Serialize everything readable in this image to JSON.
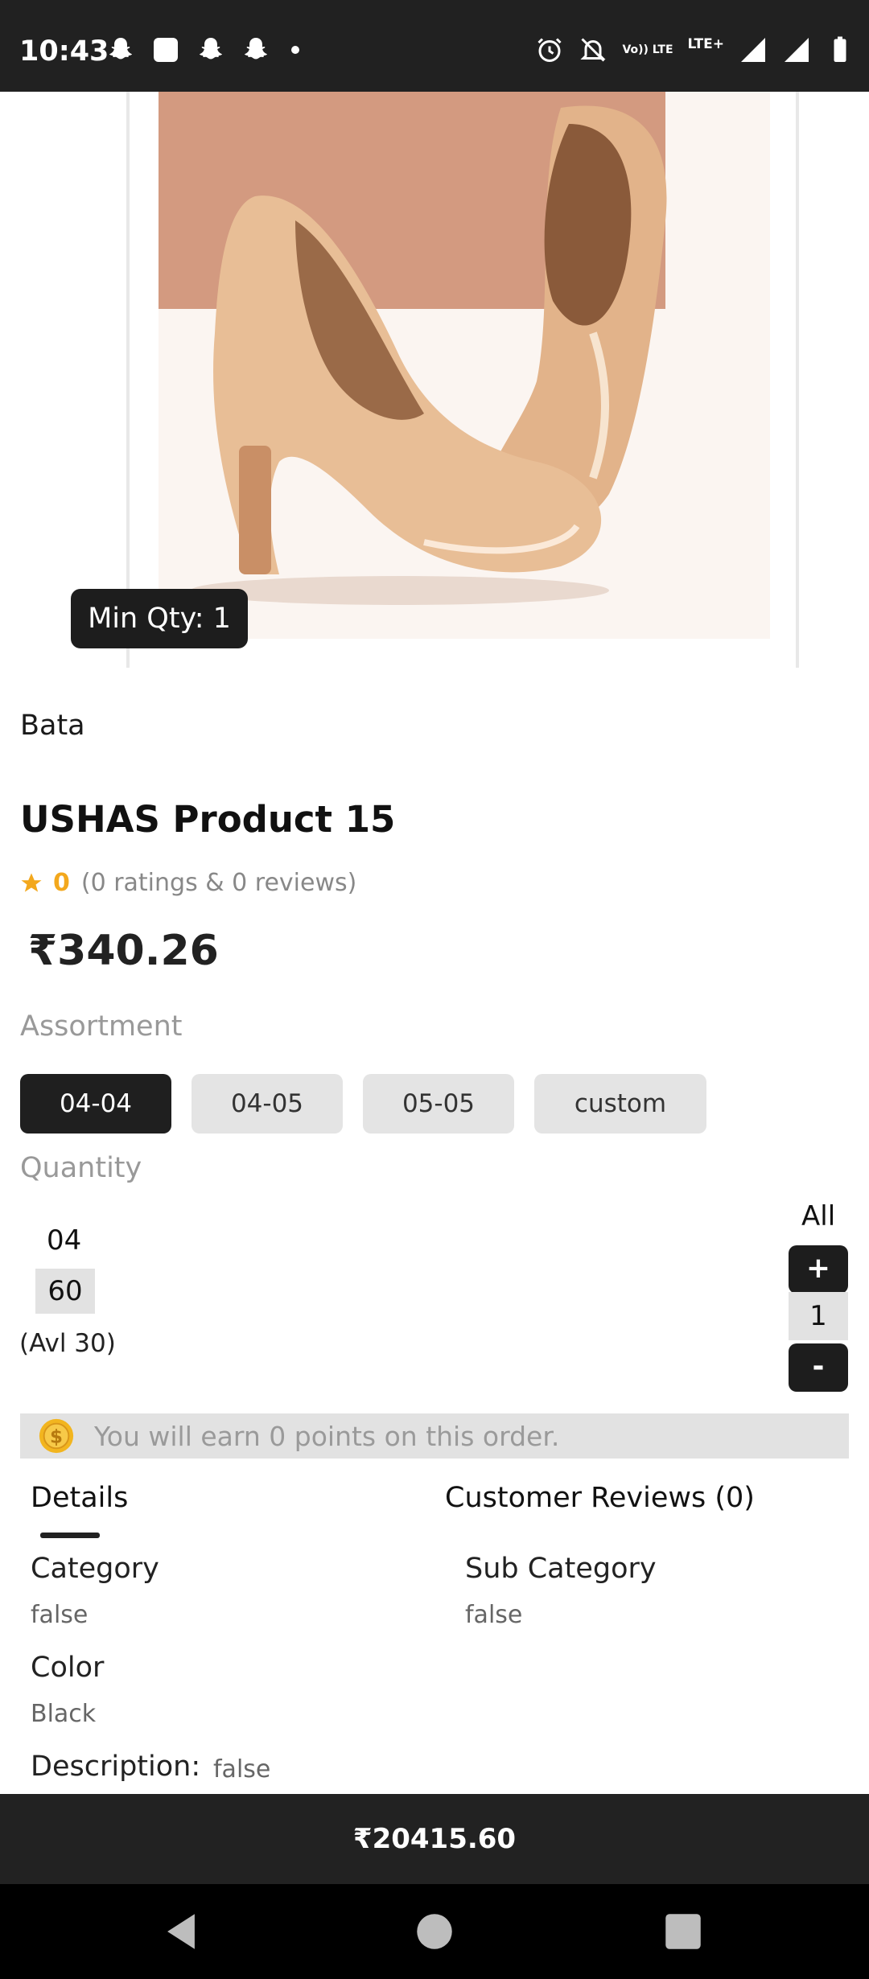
{
  "status_bar": {
    "time": "10:43",
    "left_icons": [
      "snapchat-icon",
      "square-app-icon",
      "snapchat-icon",
      "snapchat-icon",
      "dot-icon"
    ],
    "right_icons": [
      "alarm-icon",
      "notifications-off-icon",
      "volte-icon",
      "lte-icon",
      "signal-icon",
      "signal-icon",
      "battery-icon"
    ],
    "volte_label": "Vo)) LTE",
    "lte_label": "LTE+"
  },
  "product": {
    "image_icon": "product-image-nude-heels",
    "min_qty": "Min Qty: 1",
    "brand": "Bata",
    "title": "USHAS Product 15",
    "rating_value": "0",
    "rating_text": "(0 ratings & 0 reviews)",
    "price": "₹340.26"
  },
  "assortment": {
    "label": "Assortment",
    "options": [
      "04-04",
      "04-05",
      "05-05",
      "custom"
    ],
    "selected": "04-04"
  },
  "quantity": {
    "label": "Quantity",
    "size": "04",
    "value": "60",
    "available": "(Avl 30)",
    "all_label": "All",
    "plus": "+",
    "stepper_value": "1",
    "minus": "-"
  },
  "points": {
    "text": "You will earn 0 points on this order."
  },
  "tabs": {
    "details": "Details",
    "reviews": "Customer Reviews (0)",
    "active": "details"
  },
  "details": {
    "category_label": "Category",
    "category_value": "false",
    "subcategory_label": "Sub Category",
    "subcategory_value": "false",
    "color_label": "Color",
    "color_value": "Black",
    "description_label": "Description:",
    "description_value": "false"
  },
  "footer": {
    "total": "₹20415.60"
  },
  "colors": {
    "dark": "#1f1f1f",
    "chip_inactive": "#e4e4e4",
    "star": "#f3a81d"
  }
}
